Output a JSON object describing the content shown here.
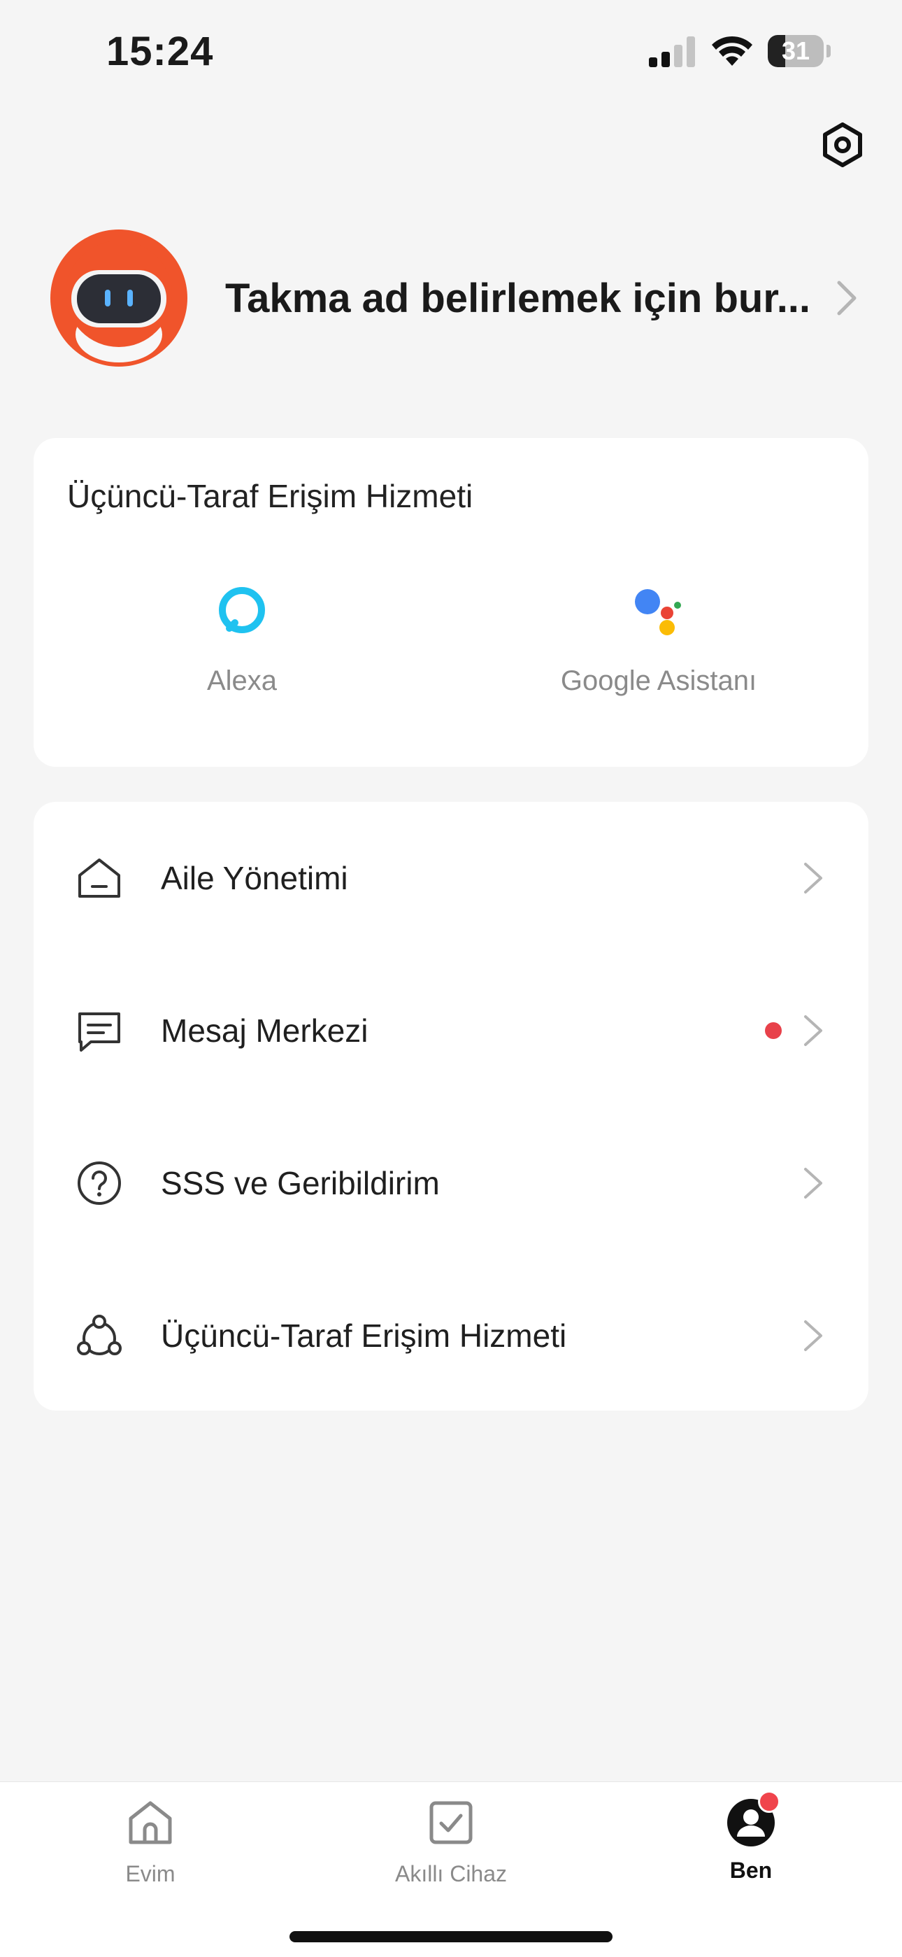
{
  "status_bar": {
    "time": "15:24",
    "battery_level": "31",
    "battery_fraction": 0.31,
    "signal_bars_active": 2,
    "signal_bars_total": 4
  },
  "header": {
    "settings_icon": "settings-hexagon-icon"
  },
  "profile": {
    "nickname": "Takma ad belirlemek için bur...",
    "avatar_icon": "robot-avatar-icon"
  },
  "third_party": {
    "title": "Üçüncü-Taraf Erişim Hizmeti",
    "items": [
      {
        "label": "Alexa",
        "icon": "alexa-icon",
        "color": "#1fc2f0"
      },
      {
        "label": "Google Asistanı",
        "icon": "google-assistant-icon"
      }
    ]
  },
  "menu": {
    "items": [
      {
        "label": "Aile Yönetimi",
        "icon": "home-icon",
        "badge": false
      },
      {
        "label": "Mesaj Merkezi",
        "icon": "message-icon",
        "badge": true
      },
      {
        "label": "SSS ve Geribildirim",
        "icon": "question-icon",
        "badge": false
      },
      {
        "label": "Üçüncü-Taraf Erişim Hizmeti",
        "icon": "share-nodes-icon",
        "badge": false
      }
    ]
  },
  "tabbar": {
    "tabs": [
      {
        "label": "Evim",
        "icon": "home-tab-icon",
        "active": false
      },
      {
        "label": "Akıllı Cihaz",
        "icon": "checkbox-tab-icon",
        "active": false
      },
      {
        "label": "Ben",
        "icon": "profile-tab-icon",
        "active": true,
        "badge": true
      }
    ]
  },
  "colors": {
    "background": "#f5f5f5",
    "card": "#ffffff",
    "badge_red": "#e8414a",
    "avatar_orange": "#f0542b",
    "text_muted": "#8a8a8a"
  }
}
